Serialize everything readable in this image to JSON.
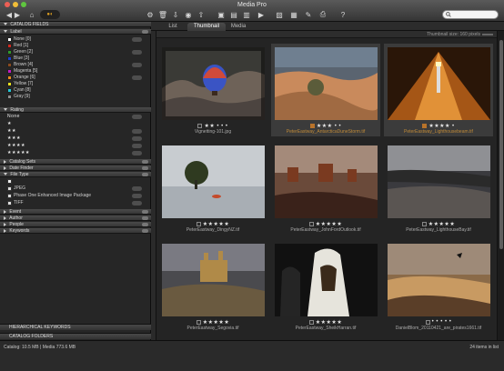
{
  "window": {
    "title": "Media Pro"
  },
  "colors": {
    "accent_orange": "#b8732a",
    "toolbar_dark": "#353535",
    "panel": "#262626",
    "grid_bg": "#242424"
  },
  "tabs": [
    {
      "label": "List",
      "active": false
    },
    {
      "label": "Thumbnail",
      "active": true
    },
    {
      "label": "Media",
      "active": false
    }
  ],
  "sidebar": {
    "title": "CATALOG FIELDS",
    "label_section": {
      "title": "Label",
      "items": [
        {
          "label": "None [0]",
          "color": "#ffffff"
        },
        {
          "label": "Red [1]",
          "color": "#d0281e"
        },
        {
          "label": "Green [2]",
          "color": "#2f9a2a"
        },
        {
          "label": "Blue [3]",
          "color": "#1e3ed0"
        },
        {
          "label": "Brown [4]",
          "color": "#8a4a1e"
        },
        {
          "label": "Magenta [5]",
          "color": "#c21ac4"
        },
        {
          "label": "Orange [6]",
          "color": "#ea8a1a"
        },
        {
          "label": "Yellow [7]",
          "color": "#e8e01e"
        },
        {
          "label": "Cyan [8]",
          "color": "#22c6d6"
        },
        {
          "label": "Gray [9]",
          "color": "#8e8e8e"
        }
      ]
    },
    "rating_section": {
      "title": "Rating",
      "items": [
        "None",
        "★",
        "★★",
        "★★★",
        "★★★★",
        "★★★★★"
      ]
    },
    "collapsed_sections": [
      "Catalog Sets",
      "Date Finder"
    ],
    "file_type_section": {
      "title": "File Type",
      "items": [
        "JPEG",
        "Phase One Enhanced Image Package",
        "TIFF"
      ]
    },
    "more_sections": [
      "Event",
      "Author",
      "People",
      "Keywords"
    ],
    "footer_sections": [
      "HIERARCHICAL KEYWORDS",
      "CATALOG FOLDERS"
    ]
  },
  "grid": {
    "info": "Thumbnail size: 160 pixels",
    "items": [
      {
        "caption": "Vignetting-101.jpg",
        "stars": "★★ • • •",
        "label_color": "",
        "caption_style": "normal"
      },
      {
        "caption": "PeterEastway_AntarcticaDuneStorm.tif",
        "stars": "★★★ • •",
        "label_color": "orange",
        "caption_style": "orange"
      },
      {
        "caption": "PeterEastway_Lighthousebeam.tif",
        "stars": "★★★★ •",
        "label_color": "orange",
        "caption_style": "orange"
      },
      {
        "caption": "PeterEastway_DingyNZ.tif",
        "stars": "★★★★★",
        "label_color": "",
        "caption_style": "normal"
      },
      {
        "caption": "PeterEastway_JohnFordOutlook.tif",
        "stars": "★★★★★",
        "label_color": "",
        "caption_style": "normal"
      },
      {
        "caption": "PeterEastway_LighthouseBay.tif",
        "stars": "★★★★★",
        "label_color": "",
        "caption_style": "normal"
      },
      {
        "caption": "PeterEastway_Segovia.tif",
        "stars": "★★★★★",
        "label_color": "",
        "caption_style": "normal"
      },
      {
        "caption": "PeterEastway_SheikHarran.tif",
        "stars": "★★★★★",
        "label_color": "",
        "caption_style": "normal"
      },
      {
        "caption": "DanielBlom_20110421_are_pirates1661.tif",
        "stars": "• • • • •",
        "label_color": "",
        "caption_style": "normal"
      }
    ]
  },
  "status": {
    "left": "Catalog: 10.5 MB  |  Media 773.6 MB",
    "right": "24 items in list"
  }
}
